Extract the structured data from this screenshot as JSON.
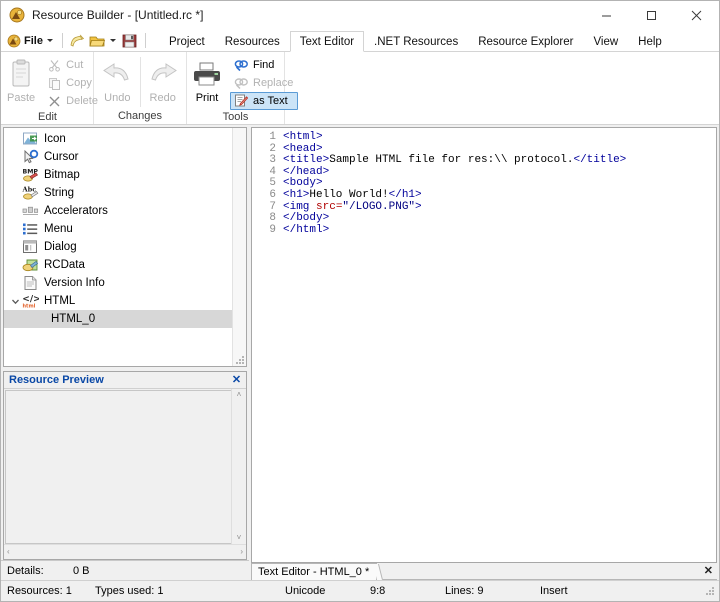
{
  "window": {
    "title": "Resource Builder - [Untitled.rc *]",
    "app_icon": "resource-builder-icon",
    "minimize": "─",
    "maximize": "□",
    "close": "×"
  },
  "quick_access": {
    "file_label": "File",
    "items": [
      {
        "name": "new-file-icon",
        "label": "New"
      },
      {
        "name": "open-file-icon",
        "label": "Open"
      },
      {
        "name": "save-file-icon",
        "label": "Save"
      }
    ]
  },
  "tabs": [
    {
      "label": "Project",
      "active": false
    },
    {
      "label": "Resources",
      "active": false
    },
    {
      "label": "Text Editor",
      "active": true
    },
    {
      "label": ".NET Resources",
      "active": false
    },
    {
      "label": "Resource Explorer",
      "active": false
    },
    {
      "label": "View",
      "active": false
    },
    {
      "label": "Help",
      "active": false
    }
  ],
  "ribbon": {
    "groups": [
      {
        "title": "Edit",
        "big": {
          "label": "Paste",
          "icon": "paste-icon",
          "enabled": false
        },
        "small": [
          {
            "label": "Cut",
            "icon": "cut-icon",
            "enabled": false
          },
          {
            "label": "Copy",
            "icon": "copy-icon",
            "enabled": false
          },
          {
            "label": "Delete",
            "icon": "delete-icon",
            "enabled": false
          }
        ]
      },
      {
        "title": "Changes",
        "big_list": [
          {
            "label": "Undo",
            "icon": "undo-icon",
            "enabled": false
          },
          {
            "label": "Redo",
            "icon": "redo-icon",
            "enabled": false
          }
        ]
      },
      {
        "title": "Tools",
        "big": {
          "label": "Print",
          "icon": "print-icon",
          "enabled": true
        },
        "small": [
          {
            "label": "Find",
            "icon": "find-icon",
            "enabled": true,
            "toggled": false
          },
          {
            "label": "Replace",
            "icon": "replace-icon",
            "enabled": false,
            "toggled": false
          },
          {
            "label": "as Text",
            "icon": "as-text-icon",
            "enabled": true,
            "toggled": true
          }
        ]
      }
    ]
  },
  "tree": {
    "items": [
      {
        "label": "Icon",
        "icon": "icon-resource-icon",
        "indent": 0,
        "expander": "",
        "selected": false
      },
      {
        "label": "Cursor",
        "icon": "cursor-resource-icon",
        "indent": 0,
        "expander": "",
        "selected": false
      },
      {
        "label": "Bitmap",
        "icon": "bitmap-resource-icon",
        "indent": 0,
        "expander": "",
        "selected": false
      },
      {
        "label": "String",
        "icon": "string-resource-icon",
        "indent": 0,
        "expander": "",
        "selected": false
      },
      {
        "label": "Accelerators",
        "icon": "accelerators-resource-icon",
        "indent": 0,
        "expander": "",
        "selected": false
      },
      {
        "label": "Menu",
        "icon": "menu-resource-icon",
        "indent": 0,
        "expander": "",
        "selected": false
      },
      {
        "label": "Dialog",
        "icon": "dialog-resource-icon",
        "indent": 0,
        "expander": "",
        "selected": false
      },
      {
        "label": "RCData",
        "icon": "rcdata-resource-icon",
        "indent": 0,
        "expander": "",
        "selected": false
      },
      {
        "label": "Version Info",
        "icon": "version-info-resource-icon",
        "indent": 0,
        "expander": "",
        "selected": false
      },
      {
        "label": "HTML",
        "icon": "html-resource-icon",
        "indent": 0,
        "expander": "expanded",
        "selected": false
      },
      {
        "label": "HTML_0",
        "icon": "",
        "indent": 1,
        "expander": "",
        "selected": true
      }
    ]
  },
  "preview": {
    "title": "Resource Preview",
    "close": "✕",
    "scroll_up": "˄",
    "scroll_down": "˅",
    "scroll_left": "‹",
    "scroll_right": "›"
  },
  "details": {
    "label": "Details:",
    "value": "0 B"
  },
  "editor": {
    "tab_label": "Text Editor - HTML_0 *",
    "tab_close": "✕",
    "line_numbers": [
      "1",
      "2",
      "3",
      "4",
      "5",
      "6",
      "7",
      "8",
      "9"
    ],
    "lines": [
      [
        {
          "t": "tg",
          "s": "<html>"
        }
      ],
      [
        {
          "t": "tg",
          "s": "<head>"
        }
      ],
      [
        {
          "t": "tg",
          "s": "<title>"
        },
        {
          "t": "tx",
          "s": "Sample HTML file for res:\\\\ protocol."
        },
        {
          "t": "tg",
          "s": "</title>"
        }
      ],
      [
        {
          "t": "tg",
          "s": "</head>"
        }
      ],
      [
        {
          "t": "tg",
          "s": "<body>"
        }
      ],
      [
        {
          "t": "tg",
          "s": "<h1>"
        },
        {
          "t": "tx",
          "s": "Hello World!"
        },
        {
          "t": "tg",
          "s": "</h1>"
        }
      ],
      [
        {
          "t": "tg",
          "s": "<img "
        },
        {
          "t": "at",
          "s": "src="
        },
        {
          "t": "vl",
          "s": "\"/LOGO.PNG\""
        },
        {
          "t": "tg",
          "s": ">"
        }
      ],
      [
        {
          "t": "tg",
          "s": "</body>"
        }
      ],
      [
        {
          "t": "tg",
          "s": "</html>"
        }
      ]
    ]
  },
  "statusbar": {
    "resources": "Resources: 1",
    "types_used": "Types used: 1",
    "encoding": "Unicode",
    "caret": "9:8",
    "lines": "Lines: 9",
    "mode": "Insert"
  },
  "colors": {
    "accent_blue": "#0a48a6",
    "tag_blue": "#00009b",
    "attr_red": "#b00000",
    "toggle_fill": "#cce4f7",
    "toggle_border": "#5b9bd5",
    "selection_gray": "#d7d7d7"
  }
}
